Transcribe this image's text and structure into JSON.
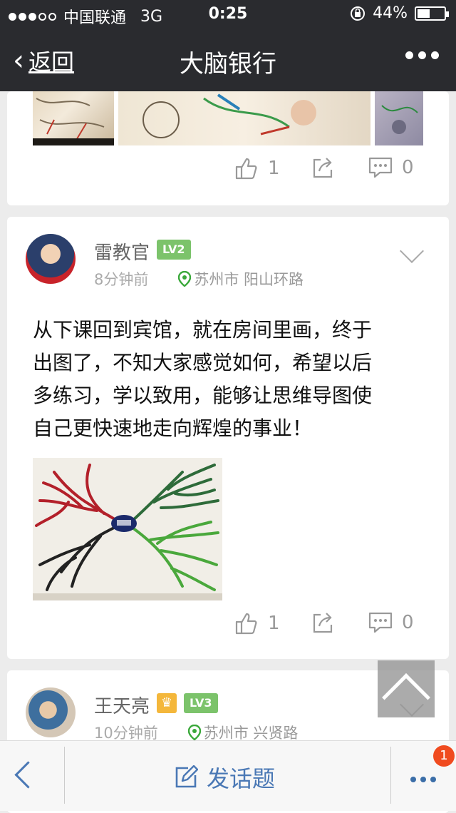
{
  "status_bar": {
    "carrier": "中国联通",
    "network": "3G",
    "time": "0:25",
    "battery_percent": "44%",
    "signal_bars_filled": 3,
    "signal_bars_total": 5,
    "battery_level": 0.44
  },
  "nav": {
    "back_label": "返回",
    "title": "大脑银行"
  },
  "posts": [
    {
      "likes": "1",
      "comments": "0"
    },
    {
      "author": "雷教官",
      "level": "LV2",
      "time_ago": "8分钟前",
      "location": "苏州市 阳山环路",
      "lines": [
        "从下课回到宾馆，就在房间里画，终于",
        "出图了，不知大家感觉如何，希望以后",
        "多练习，学以致用，能够让思维导图使",
        "自己更快速地走向辉煌的事业！"
      ],
      "likes": "1",
      "comments": "0"
    },
    {
      "author": "王天亮",
      "level": "LV3",
      "time_ago": "10分钟前",
      "location": "苏州市 兴贤路"
    }
  ],
  "bottom_bar": {
    "compose_label": "发话题",
    "badge_count": "1"
  },
  "colors": {
    "nav_bg": "#2a2b2f",
    "accent_blue": "#4a78b5",
    "level_green": "#7cc36b",
    "badge_red": "#f04b1f",
    "location_green": "#3aa83a"
  }
}
